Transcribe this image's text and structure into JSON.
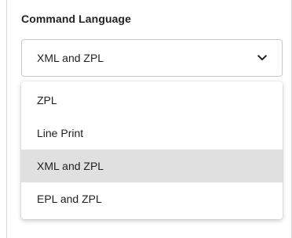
{
  "field": {
    "label": "Command Language",
    "selected_value": "XML and ZPL"
  },
  "icons": {
    "dropdown": "chevron-down-icon"
  },
  "options": [
    {
      "label": "ZPL",
      "selected": false
    },
    {
      "label": "Line Print",
      "selected": false
    },
    {
      "label": "XML and ZPL",
      "selected": true
    },
    {
      "label": "EPL and ZPL",
      "selected": false
    }
  ],
  "colors": {
    "selected_option_bg": "#e0e0e0",
    "border": "#c8c8c8"
  }
}
